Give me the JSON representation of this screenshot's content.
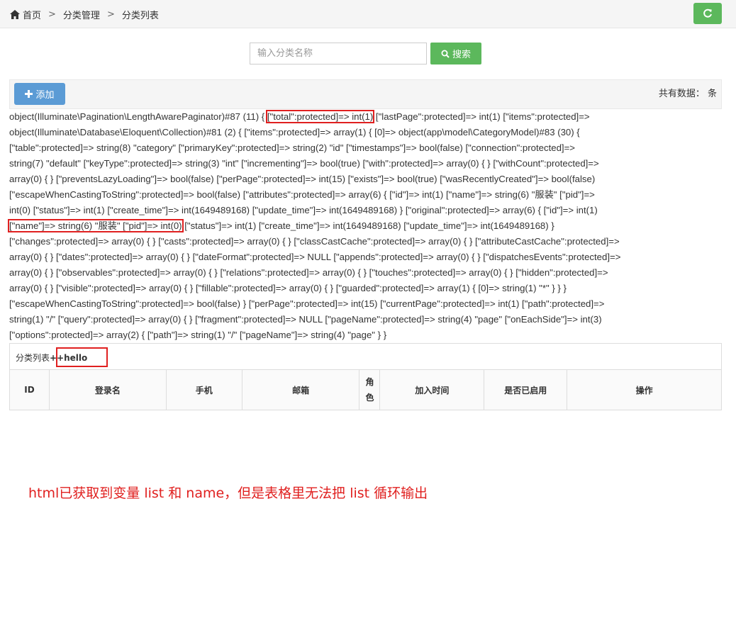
{
  "breadcrumb": {
    "home": "首页",
    "sep": ">",
    "level2": "分类管理",
    "level3": "分类列表"
  },
  "search": {
    "placeholder": "输入分类名称",
    "button": "搜索"
  },
  "toolbar": {
    "add_button": "添加",
    "total_label": "共有数据：",
    "total_unit": "条"
  },
  "dump_lines": [
    "object(Illuminate\\Pagination\\LengthAwarePaginator)#87 (11) { ",
    "[\"total\":protected]=> int(1)",
    " [\"lastPage\":protected]=> int(1) [\"items\":protected]=>",
    "object(Illuminate\\Database\\Eloquent\\Collection)#81 (2) { [\"items\":protected]=> array(1) { [0]=> object(app\\model\\CategoryModel)#83 (30) {",
    "[\"table\":protected]=> string(8) \"category\" [\"primaryKey\":protected]=> string(2) \"id\" [\"timestamps\"]=> bool(false) [\"connection\":protected]=>",
    "string(7) \"default\" [\"keyType\":protected]=> string(3) \"int\" [\"incrementing\"]=> bool(true) [\"with\":protected]=> array(0) { } [\"withCount\":protected]=>",
    "array(0) { } [\"preventsLazyLoading\"]=> bool(false) [\"perPage\":protected]=> int(15) [\"exists\"]=> bool(true) [\"wasRecentlyCreated\"]=> bool(false)",
    "[\"escapeWhenCastingToString\":protected]=> bool(false) [\"attributes\":protected]=> array(6) { [\"id\"]=> int(1) [\"name\"]=> string(6) \"服装\" [\"pid\"]=>",
    "int(0) [\"status\"]=> int(1) [\"create_time\"]=> int(1649489168) [\"update_time\"]=> int(1649489168) } [\"original\":protected]=> array(6) { [\"id\"]=> int(1)",
    "[\"name\"]=> string(6) \"服装\" [\"pid\"]=> int(0)",
    " [\"status\"]=> int(1) [\"create_time\"]=> int(1649489168) [\"update_time\"]=> int(1649489168) }",
    "[\"changes\":protected]=> array(0) { } [\"casts\":protected]=> array(0) { } [\"classCastCache\":protected]=> array(0) { } [\"attributeCastCache\":protected]=>",
    "array(0) { } [\"dates\":protected]=> array(0) { } [\"dateFormat\":protected]=> NULL [\"appends\":protected]=> array(0) { } [\"dispatchesEvents\":protected]=>",
    "array(0) { } [\"observables\":protected]=> array(0) { } [\"relations\":protected]=> array(0) { } [\"touches\":protected]=> array(0) { } [\"hidden\":protected]=>",
    "array(0) { } [\"visible\":protected]=> array(0) { } [\"fillable\":protected]=> array(0) { } [\"guarded\":protected]=> array(1) { [0]=> string(1) \"*\" } } }",
    "[\"escapeWhenCastingToString\":protected]=> bool(false) } [\"perPage\":protected]=> int(15) [\"currentPage\":protected]=> int(1) [\"path\":protected]=>",
    "string(1) \"/\" [\"query\":protected]=> array(0) { } [\"fragment\":protected]=> NULL [\"pageName\":protected]=> string(4) \"page\" [\"onEachSide\"]=> int(3)",
    "[\"options\":protected]=> array(2) { [\"path\"]=> string(1) \"/\" [\"pageName\"]=> string(4) \"page\" } }"
  ],
  "panel": {
    "title": "分类列表",
    "suffix": "++hello"
  },
  "table": {
    "columns": [
      "ID",
      "登录名",
      "手机",
      "邮箱",
      "角色",
      "加入时间",
      "是否已启用",
      "操作"
    ]
  },
  "note": "html已获取到变量 list 和 name，但是表格里无法把 list 循环输出",
  "colors": {
    "green": "#5cb85c",
    "blue": "#5b9bd5",
    "annotation_red": "#e02020"
  },
  "icons": [
    "home-icon",
    "refresh-icon",
    "search-icon",
    "plus-icon"
  ]
}
